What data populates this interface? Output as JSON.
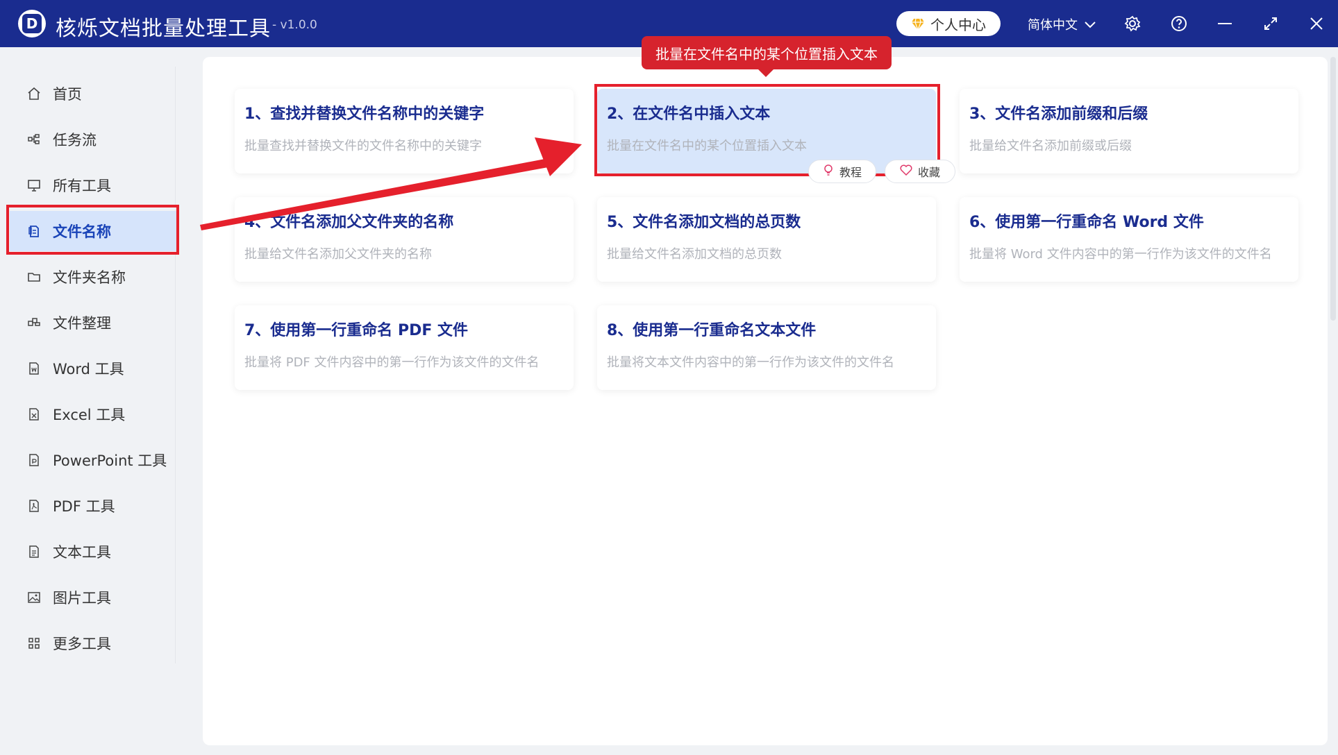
{
  "app": {
    "logo_letter": "D",
    "title": "核烁文档批量处理工具",
    "version": "- v1.0.0",
    "user_center": "个人中心",
    "language": "简体中文"
  },
  "sidebar": {
    "items": [
      {
        "label": "首页",
        "icon": "home-icon"
      },
      {
        "label": "任务流",
        "icon": "workflow-icon"
      },
      {
        "label": "所有工具",
        "icon": "monitor-icon"
      },
      {
        "label": "文件名称",
        "icon": "file-name-icon"
      },
      {
        "label": "文件夹名称",
        "icon": "folder-icon"
      },
      {
        "label": "文件整理",
        "icon": "organize-icon"
      },
      {
        "label": "Word 工具",
        "icon": "word-icon"
      },
      {
        "label": "Excel 工具",
        "icon": "excel-icon"
      },
      {
        "label": "PowerPoint 工具",
        "icon": "powerpoint-icon"
      },
      {
        "label": "PDF 工具",
        "icon": "pdf-icon"
      },
      {
        "label": "文本工具",
        "icon": "text-icon"
      },
      {
        "label": "图片工具",
        "icon": "image-icon"
      },
      {
        "label": "更多工具",
        "icon": "grid-icon"
      }
    ],
    "active_index": 3
  },
  "tooltip": "批量在文件名中的某个位置插入文本",
  "cards": [
    {
      "title": "1、查找并替换文件名称中的关键字",
      "desc": "批量查找并替换文件的文件名称中的关键字"
    },
    {
      "title": "2、在文件名中插入文本",
      "desc": "批量在文件名中的某个位置插入文本"
    },
    {
      "title": "3、文件名添加前缀和后缀",
      "desc": "批量给文件名添加前缀或后缀"
    },
    {
      "title": "4、文件名添加父文件夹的名称",
      "desc": "批量给文件名添加父文件夹的名称"
    },
    {
      "title": "5、文件名添加文档的总页数",
      "desc": "批量给文件名添加文档的总页数"
    },
    {
      "title": "6、使用第一行重命名 Word 文件",
      "desc": "批量将 Word 文件内容中的第一行作为该文件的文件名"
    },
    {
      "title": "7、使用第一行重命名 PDF 文件",
      "desc": "批量将 PDF 文件内容中的第一行作为该文件的文件名"
    },
    {
      "title": "8、使用第一行重命名文本文件",
      "desc": "批量将文本文件内容中的第一行作为该文件的文件名"
    }
  ],
  "card_actions": {
    "tutorial": "教程",
    "favorite": "收藏"
  },
  "colors": {
    "titlebar": "#1a2c8f",
    "accent": "#1a44b8",
    "highlight_red": "#e5202c",
    "card_highlight_bg": "#d8e6fb"
  }
}
